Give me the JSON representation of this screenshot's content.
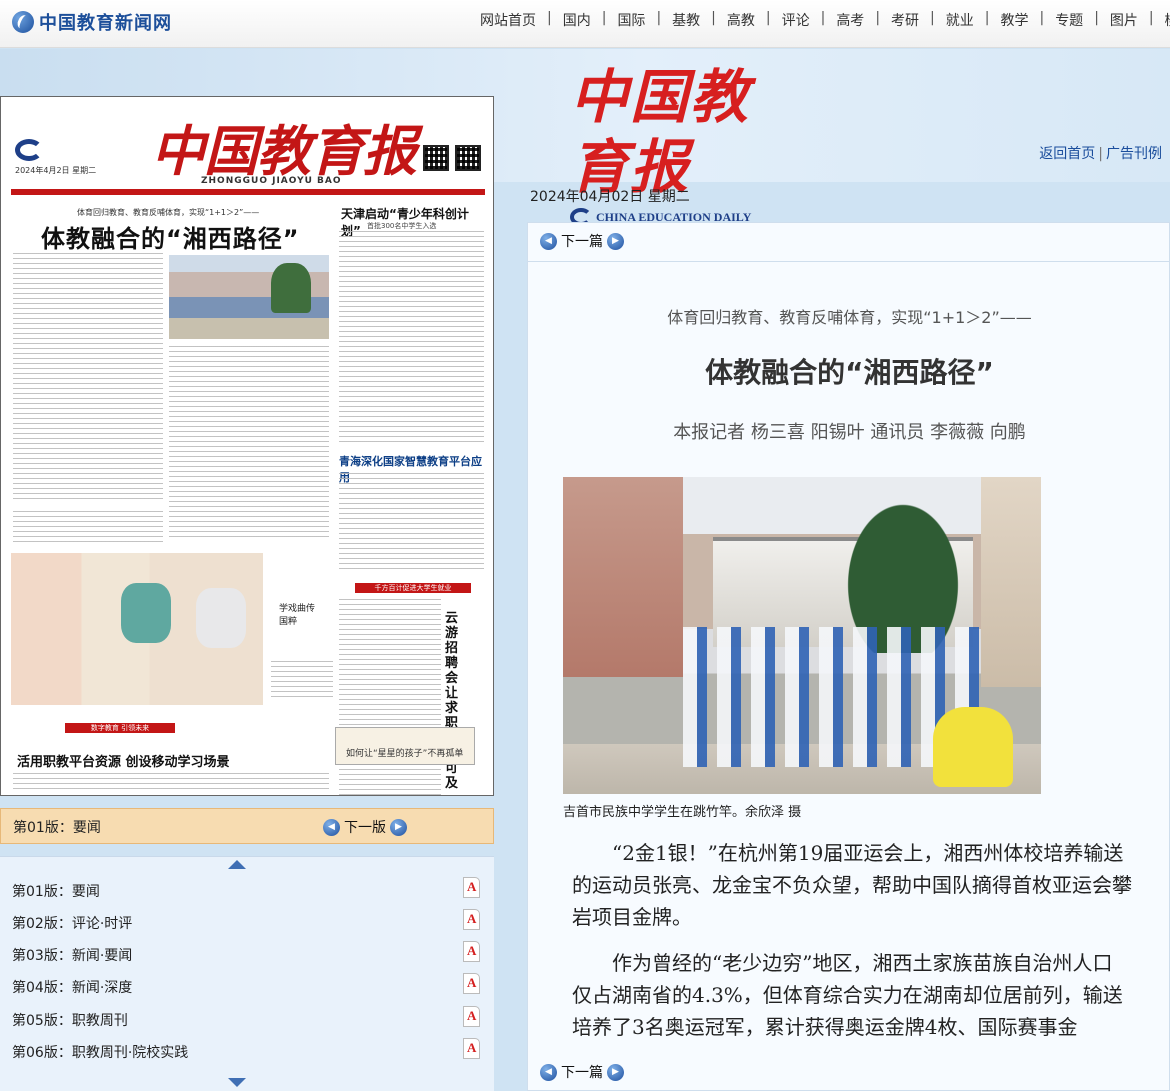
{
  "site": {
    "logo_text": "中国教育新闻网",
    "nav": [
      "网站首页",
      "国内",
      "国际",
      "基教",
      "高教",
      "评论",
      "高考",
      "考研",
      "就业",
      "教学",
      "专题",
      "图片",
      "桃"
    ]
  },
  "masthead": {
    "title_cn": "中国教育报",
    "title_en": "CHINA EDUCATION DAILY"
  },
  "toplinks": {
    "home": "返回首页",
    "archive": "广告刊例",
    "sep": "|"
  },
  "date": "2024年04月02日 星期二",
  "newspaper_page": {
    "title": "中国教育报",
    "pinyin": "ZHONGGUO JIAOYU BAO",
    "date_small": "2024年4月2日 星期二",
    "kicker": "体育回归教育、教育反哺体育，实现“1+1＞2”——",
    "headline": "体教融合的“湘西路径”",
    "side_headline": "天津启动“青少年科创计划”",
    "side_sub": "首批300名中学生入选",
    "mid_headline": "青海深化国家智慧教育平台应用",
    "photo_caption": "学戏曲传国粹",
    "vertical_headline": "云游招聘会让求职触屏可及",
    "bottom_headline": "活用职教平台资源 创设移动学习场景",
    "box_text": "如何让“星星的孩子”不再孤单",
    "red_bar_1": "千方百计促进大学生就业",
    "red_bar_2": "数字教育 引领未来"
  },
  "current_edition": {
    "label": "第01版：要闻",
    "next": "下一版"
  },
  "editions": [
    {
      "label": "第01版：要闻"
    },
    {
      "label": "第02版：评论·时评"
    },
    {
      "label": "第03版：新闻·要闻"
    },
    {
      "label": "第04版：新闻·深度"
    },
    {
      "label": "第05版：职教周刊"
    },
    {
      "label": "第06版：职教周刊·院校实践"
    }
  ],
  "article": {
    "next_label": "下一篇",
    "kicker": "体育回归教育、教育反哺体育，实现“1+1＞2”——",
    "title": "体教融合的“湘西路径”",
    "byline": "本报记者 杨三喜 阳锡叶 通讯员 李薇薇 向鹏",
    "photo_caption": "吉首市民族中学学生在跳竹竿。余欣泽 摄",
    "paragraphs": [
      "“2金1银！”在杭州第19届亚运会上，湘西州体校培养输送的运动员张亮、龙金宝不负众望，帮助中国队摘得首枚亚运会攀岩项目金牌。",
      "作为曾经的“老少边穷”地区，湘西土家族苗族自治州人口仅占湖南省的4.3%，但体育综合实力在湖南却位居前列，输送培养了3名奥运冠军，累计获得奥运金牌4枚、国际赛事金"
    ]
  }
}
